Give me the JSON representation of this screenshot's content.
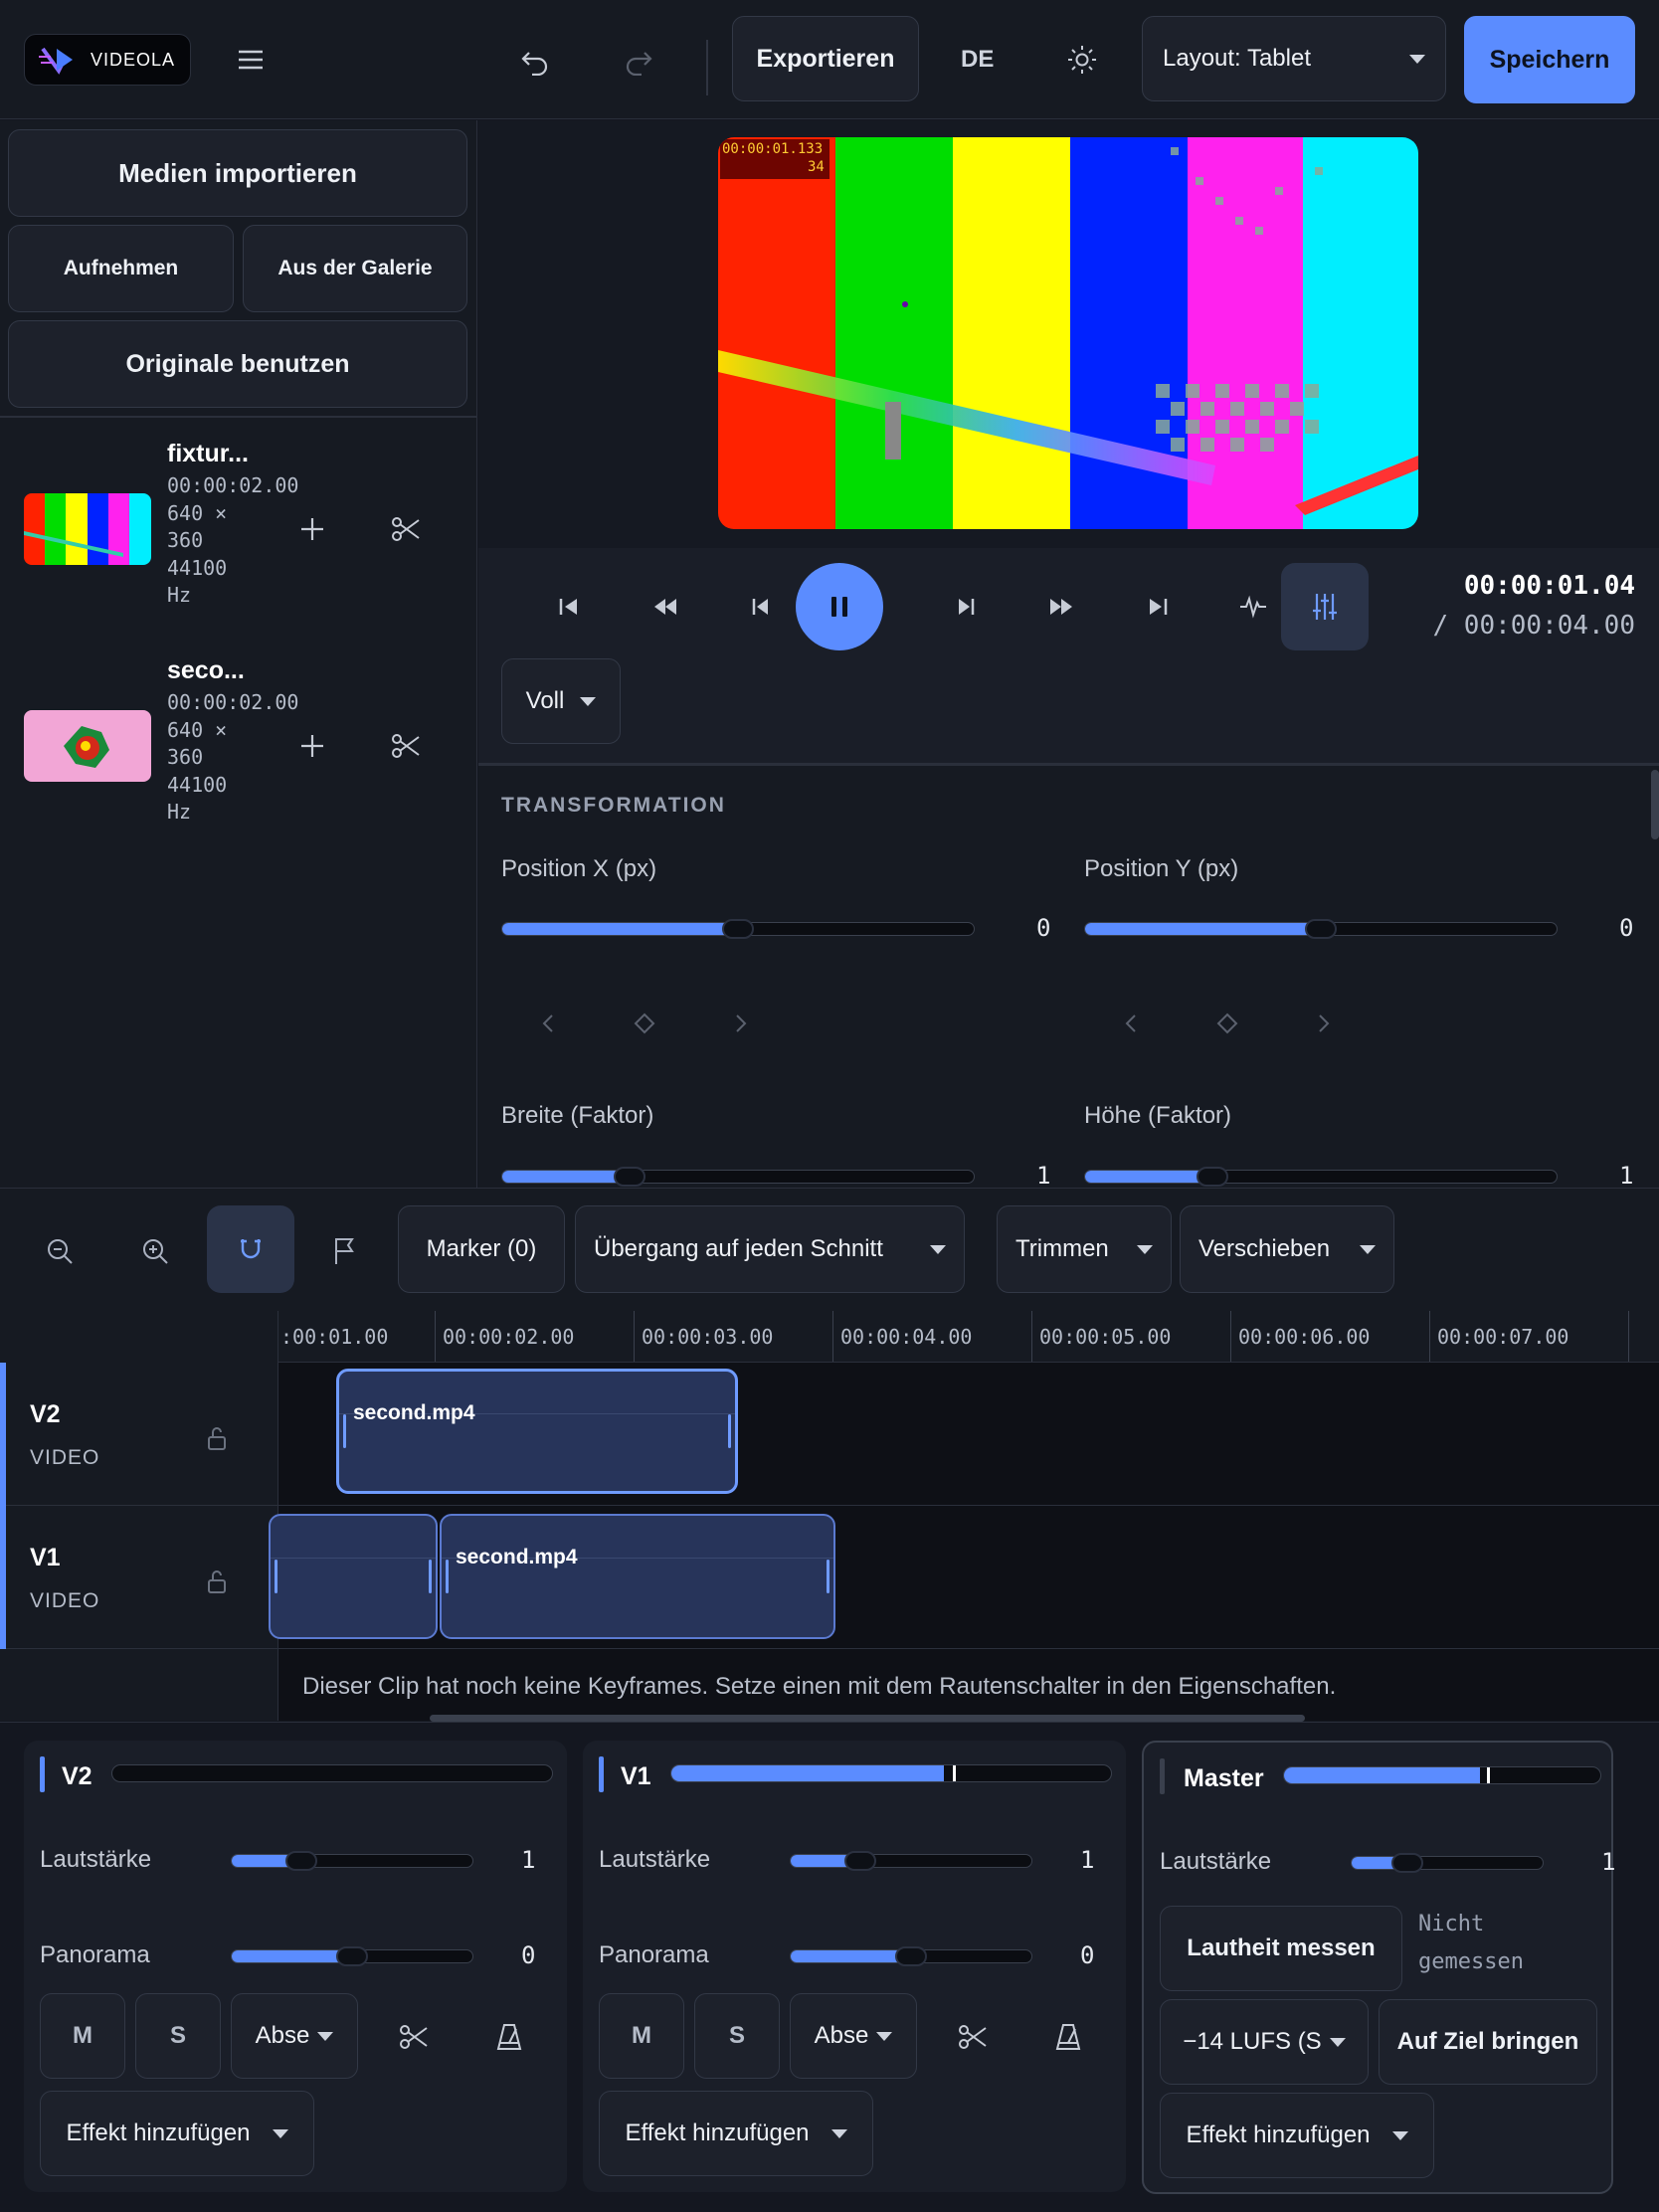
{
  "app": {
    "logo_text": "VIDEOLA",
    "export": "Exportieren",
    "lang": "DE",
    "layout_select": "Layout: Tablet",
    "save": "Speichern"
  },
  "media": {
    "import": "Medien importieren",
    "record": "Aufnehmen",
    "gallery": "Aus der Galerie",
    "originals": "Originale benutzen",
    "items": [
      {
        "name": "fixtur...",
        "duration": "00:00:02.00",
        "dim1": "640 ×",
        "dim2": "360",
        "rate": "44100",
        "unit": "Hz"
      },
      {
        "name": "seco...",
        "duration": "00:00:02.00",
        "dim1": "640 ×",
        "dim2": "360",
        "rate": "44100",
        "unit": "Hz"
      }
    ]
  },
  "preview": {
    "overlay_time": "00:00:01.133",
    "overlay_frame": "34"
  },
  "transport": {
    "time_current": "00:00:01.04",
    "time_total": "/ 00:00:04.00",
    "quality": "Voll"
  },
  "props": {
    "section": "TRANSFORMATION",
    "pos_x": {
      "label": "Position X (px)",
      "value": "0",
      "level": 0.5
    },
    "pos_y": {
      "label": "Position Y (px)",
      "value": "0",
      "level": 0.5
    },
    "width": {
      "label": "Breite (Faktor)",
      "value": "1",
      "level": 0.27
    },
    "height": {
      "label": "Höhe (Faktor)",
      "value": "1",
      "level": 0.27
    }
  },
  "toolbar": {
    "marker": "Marker (0)",
    "transition": "Übergang auf jeden Schnitt",
    "trim": "Trimmen",
    "move": "Verschieben"
  },
  "ruler": {
    "ticks": [
      ":00:01.00",
      "00:00:02.00",
      "00:00:03.00",
      "00:00:04.00",
      "00:00:05.00",
      "00:00:06.00",
      "00:00:07.00"
    ]
  },
  "tracks": [
    {
      "id": "V2",
      "type": "VIDEO",
      "clip": "second.mp4"
    },
    {
      "id": "V1",
      "type": "VIDEO",
      "clip": "second.mp4"
    }
  ],
  "hint": "Dieser Clip hat noch keine Keyframes. Setze einen mit dem Rautenschalter in den Eigenschaften.",
  "mixer": {
    "v2": {
      "name": "V2",
      "meter": 0,
      "vol_label": "Lautstärke",
      "vol_value": "1",
      "vol_level": 0.29,
      "pan_label": "Panorama",
      "pan_value": "0",
      "pan_level": 0.5,
      "mute": "M",
      "solo": "S",
      "send": "Abse",
      "fx": "Effekt hinzufügen"
    },
    "v1": {
      "name": "V1",
      "meter": 0.62,
      "vol_label": "Lautstärke",
      "vol_value": "1",
      "vol_level": 0.29,
      "pan_label": "Panorama",
      "pan_value": "0",
      "pan_level": 0.5,
      "mute": "M",
      "solo": "S",
      "send": "Abse",
      "fx": "Effekt hinzufügen"
    },
    "master": {
      "name": "Master",
      "meter": 0.62,
      "vol_label": "Lautstärke",
      "vol_value": "1",
      "vol_level": 0.29,
      "measure": "Lautheit messen",
      "measure_status_1": "Nicht",
      "measure_status_2": "gemessen",
      "target": "−14 LUFS (S",
      "apply": "Auf Ziel bringen",
      "fx": "Effekt hinzufügen"
    }
  },
  "colors": {
    "accent": "#5b8cff",
    "bg": "#141720",
    "panel": "#1a1e28"
  }
}
